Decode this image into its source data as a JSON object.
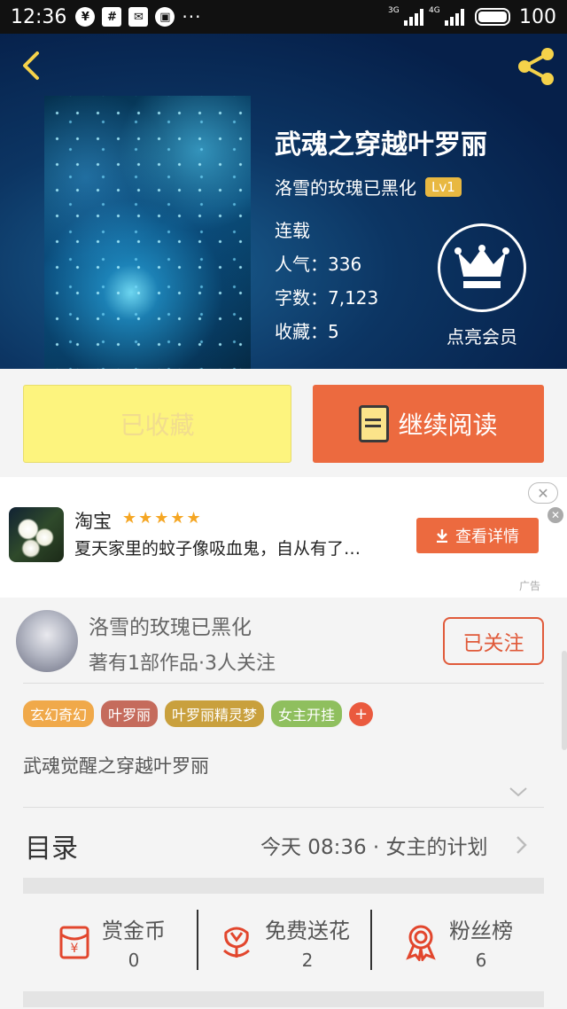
{
  "status_bar": {
    "time": "12:36",
    "icons": [
      "yuan-icon",
      "hashtag-icon",
      "mail-icon",
      "shirt-icon",
      "more-dots-icon"
    ],
    "dots": "···",
    "net1": "3G",
    "net2": "4G",
    "battery": "100"
  },
  "book": {
    "title": "武魂之穿越叶罗丽",
    "author": "洛雪的玫瑰已黑化",
    "level": "Lv1",
    "status": "连载",
    "popularity": "人气：336",
    "word_count": "字数：7,123",
    "favorites": "收藏：5",
    "vip_label": "点亮会员"
  },
  "actions": {
    "collected_label": "已收藏",
    "read_label": "继续阅读"
  },
  "ad": {
    "app_name": "淘宝",
    "stars": "★★★★★",
    "text": "夏天家里的蚊子像吸血鬼，自从有了…",
    "button_label": "查看详情",
    "tag": "广告"
  },
  "author_card": {
    "name": "洛雪的玫瑰已黑化",
    "works": "著有1部作品·3人关注",
    "follow_label": "已关注"
  },
  "tags": [
    {
      "label": "玄幻奇幻",
      "color": "#f0a94a"
    },
    {
      "label": "叶罗丽",
      "color": "#c56b5c"
    },
    {
      "label": "叶罗丽精灵梦",
      "color": "#c9a03d"
    },
    {
      "label": "女主开挂",
      "color": "#8fbf5e"
    }
  ],
  "tag_plus": "+",
  "description": "武魂觉醒之穿越叶罗丽",
  "toc": {
    "title": "目录",
    "latest": "今天 08:36 · 女主的计划"
  },
  "stats": [
    {
      "label": "赏金币",
      "value": "0",
      "icon": "red-envelope-icon"
    },
    {
      "label": "免费送花",
      "value": "2",
      "icon": "flower-icon"
    },
    {
      "label": "粉丝榜",
      "value": "6",
      "icon": "medal-icon"
    }
  ],
  "colors": {
    "accent": "#ec6a3f",
    "collected_bg": "#fdf47e",
    "header_bg": "#0a2a55"
  }
}
